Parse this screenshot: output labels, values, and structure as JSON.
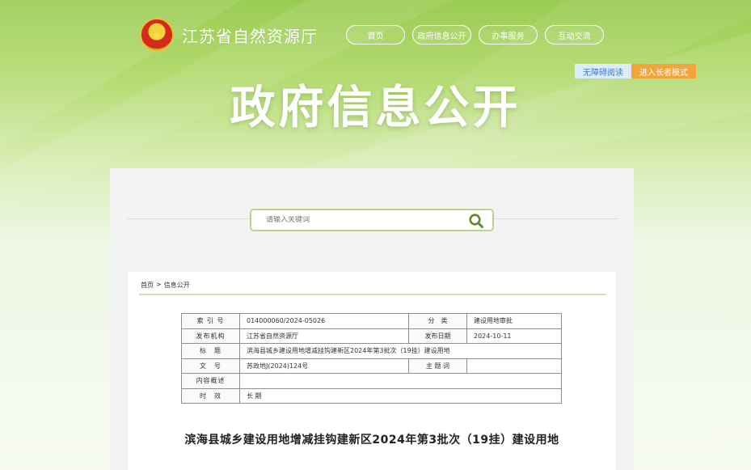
{
  "header": {
    "site_title": "江苏省自然资源厅",
    "emblem_glyph": "★",
    "nav": [
      "首页",
      "政府信息公开",
      "办事服务",
      "互动交流"
    ],
    "accessibility": {
      "barrier_free": "无障碍阅读",
      "elder_mode": "进入长者模式"
    },
    "banner_title": "政府信息公开"
  },
  "search": {
    "placeholder": "请输入关键词"
  },
  "breadcrumb": {
    "home": "首页",
    "sep": ">",
    "current": "信息公开"
  },
  "meta_table": {
    "rows": [
      {
        "label": "索 引 号",
        "value": "014000060/2024-05026",
        "label2": "分　类",
        "value2": "建设用地审批"
      },
      {
        "label": "发布机构",
        "value": "江苏省自然资源厅",
        "label2": "发布日期",
        "value2": "2024-10-11"
      },
      {
        "label": "标　题",
        "value": "滨海县城乡建设用地增减挂钩建新区2024年第3批次（19挂）建设用地"
      },
      {
        "label": "文　号",
        "value": "苏政地J(2024)124号",
        "label2": "主 题 词",
        "value2": ""
      },
      {
        "label": "内容概述",
        "value": ""
      },
      {
        "label": "时　效",
        "value": "长 期"
      }
    ]
  },
  "document": {
    "title": "滨海县城乡建设用地增减挂钩建新区2024年第3批次（19挂）建设用地"
  },
  "colors": {
    "accent_green": "#9acc52",
    "elder_orange": "#f3a53b",
    "barrier_blue": "#dcecff"
  }
}
